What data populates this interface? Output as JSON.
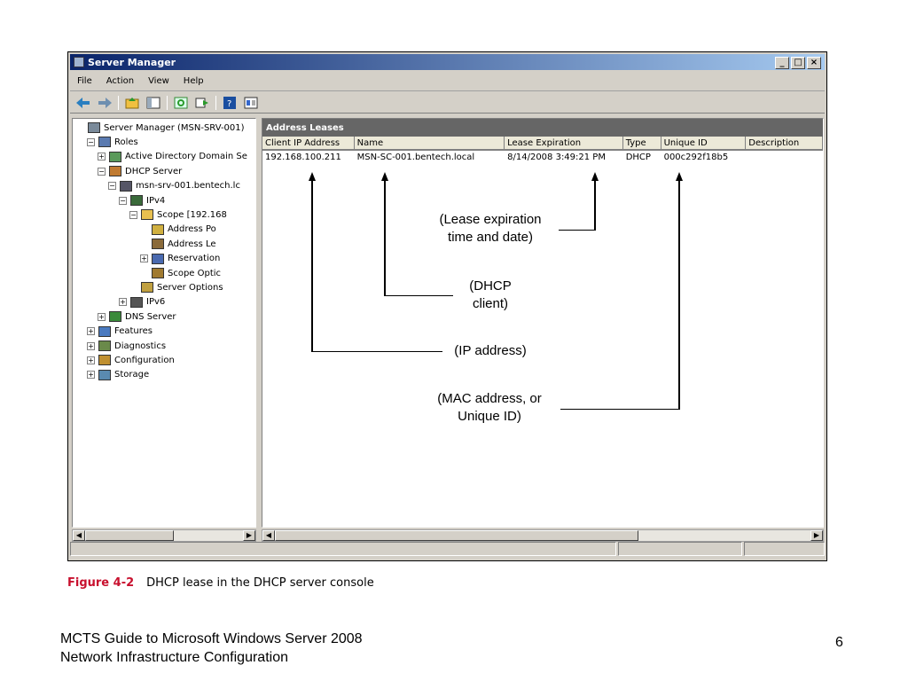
{
  "window": {
    "title": "Server Manager",
    "controls": [
      "_",
      "□",
      "×"
    ]
  },
  "menu": [
    "File",
    "Action",
    "View",
    "Help"
  ],
  "toolbar_icons": [
    "back-arrow-icon",
    "forward-arrow-icon",
    "folder-up-icon",
    "show-hide-tree-icon",
    "refresh-icon",
    "export-icon",
    "help-icon",
    "properties-icon"
  ],
  "tree": [
    {
      "label": "Server Manager (MSN-SRV-001)",
      "indent": 0,
      "exp": "",
      "icon": "server-icon"
    },
    {
      "label": "Roles",
      "indent": 1,
      "exp": "−",
      "icon": "roles-icon"
    },
    {
      "label": "Active Directory Domain Se",
      "indent": 2,
      "exp": "+",
      "icon": "ad-icon"
    },
    {
      "label": "DHCP Server",
      "indent": 2,
      "exp": "−",
      "icon": "dhcp-icon"
    },
    {
      "label": "msn-srv-001.bentech.lc",
      "indent": 3,
      "exp": "−",
      "icon": "server-node-icon"
    },
    {
      "label": "IPv4",
      "indent": 4,
      "exp": "−",
      "icon": "ipv4-icon"
    },
    {
      "label": "Scope [192.168",
      "indent": 5,
      "exp": "−",
      "icon": "folder-icon"
    },
    {
      "label": "Address Po",
      "indent": 6,
      "exp": "",
      "icon": "address-pool-icon"
    },
    {
      "label": "Address Le",
      "indent": 6,
      "exp": "",
      "icon": "address-leases-icon"
    },
    {
      "label": "Reservation",
      "indent": 6,
      "exp": "+",
      "icon": "reservations-icon"
    },
    {
      "label": "Scope Optic",
      "indent": 6,
      "exp": "",
      "icon": "scope-options-icon"
    },
    {
      "label": "Server Options",
      "indent": 5,
      "exp": "",
      "icon": "server-options-icon"
    },
    {
      "label": "IPv6",
      "indent": 4,
      "exp": "+",
      "icon": "ipv6-icon"
    },
    {
      "label": "DNS Server",
      "indent": 2,
      "exp": "+",
      "icon": "dns-icon"
    },
    {
      "label": "Features",
      "indent": 1,
      "exp": "+",
      "icon": "features-icon"
    },
    {
      "label": "Diagnostics",
      "indent": 1,
      "exp": "+",
      "icon": "diagnostics-icon"
    },
    {
      "label": "Configuration",
      "indent": 1,
      "exp": "+",
      "icon": "configuration-icon"
    },
    {
      "label": "Storage",
      "indent": 1,
      "exp": "+",
      "icon": "storage-icon"
    }
  ],
  "panel_title": "Address Leases",
  "columns": [
    "Client IP Address",
    "Name",
    "Lease Expiration",
    "Type",
    "Unique ID",
    "Description"
  ],
  "rows": [
    [
      "192.168.100.211",
      "MSN-SC-001.bentech.local",
      "8/14/2008 3:49:21 PM",
      "DHCP",
      "000c292f18b5",
      ""
    ]
  ],
  "callouts": {
    "lease": [
      "(Lease expiration",
      "time and date)"
    ],
    "client": [
      "(DHCP",
      "client)"
    ],
    "ip": [
      "(IP address)"
    ],
    "mac": [
      "(MAC address, or",
      "Unique ID)"
    ]
  },
  "caption": {
    "figure": "Figure 4-2",
    "text": "DHCP lease in the DHCP server console"
  },
  "footer": {
    "line1": "MCTS Guide to Microsoft Windows Server 2008",
    "line2": "Network Infrastructure Configuration",
    "page": "6"
  },
  "colors": {
    "title_bar_start": "#0a246a",
    "title_bar_end": "#a6caf0",
    "panel_header": "#666666",
    "figure_label": "#c8102e"
  }
}
